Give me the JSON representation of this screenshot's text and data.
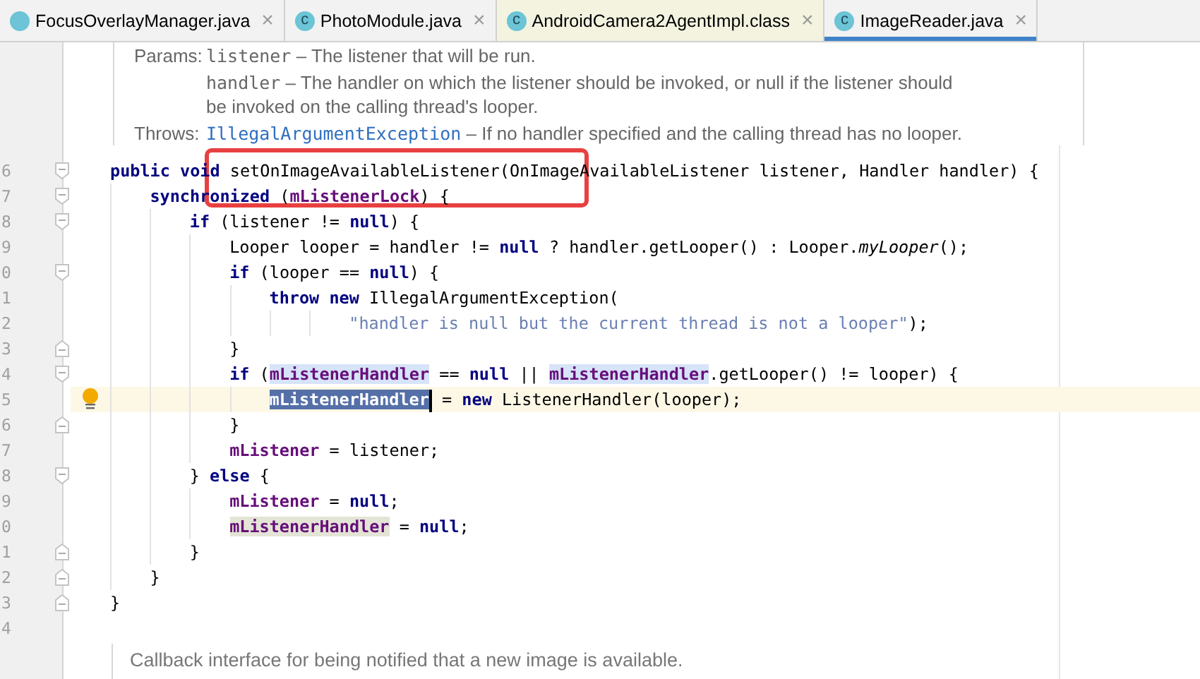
{
  "tabs": [
    {
      "label": "FocusOverlayManager.java",
      "kind": "java",
      "selected": false,
      "close": "×"
    },
    {
      "label": "PhotoModule.java",
      "kind": "java",
      "selected": false,
      "close": "×",
      "badge": "c"
    },
    {
      "label": "AndroidCamera2AgentImpl.class",
      "kind": "class",
      "selected": false,
      "close": "×",
      "badge": "c"
    },
    {
      "label": "ImageReader.java",
      "kind": "java",
      "selected": true,
      "close": "×",
      "badge": "c"
    }
  ],
  "doc_top": {
    "params_label": "Params:",
    "params": [
      {
        "name": "listener",
        "text": "– The listener that will be run."
      },
      {
        "name": "handler",
        "text": "– The handler on which the listener should be invoked, or null if the listener should be invoked on the calling thread's looper."
      }
    ],
    "throws_label": "Throws:",
    "throws": {
      "name": "IllegalArgumentException",
      "text": "– If no handler specified and the calling thread has no looper."
    }
  },
  "code_lines": [
    {
      "number": "6",
      "kind": "statement",
      "fold_start": true,
      "fold_end": false,
      "current": false,
      "bulb": false,
      "tokens": [
        {
          "kind": "keyword",
          "text": "public void"
        },
        {
          "kind": "plain",
          "text": " setOnImageAvailableListener(OnImageAvailableListener listener, Handler handler) {"
        }
      ],
      "children": [
        {
          "number": "7",
          "kind": "statement",
          "fold_start": true,
          "fold_end": false,
          "current": false,
          "bulb": false,
          "tokens": [
            {
              "kind": "keyword",
              "text": "synchronized"
            },
            {
              "kind": "plain",
              "text": " ("
            },
            {
              "kind": "field",
              "text": "mListenerLock"
            },
            {
              "kind": "plain",
              "text": ") {"
            }
          ],
          "children": [
            {
              "number": "8",
              "kind": "statement",
              "fold_start": true,
              "fold_end": false,
              "current": false,
              "bulb": false,
              "tokens": [
                {
                  "kind": "keyword",
                  "text": "if"
                },
                {
                  "kind": "plain",
                  "text": " (listener != "
                },
                {
                  "kind": "keyword",
                  "text": "null"
                },
                {
                  "kind": "plain",
                  "text": ") {"
                }
              ],
              "children": [
                {
                  "number": "9",
                  "kind": "statement",
                  "fold_start": false,
                  "fold_end": false,
                  "current": false,
                  "bulb": false,
                  "tokens": [
                    {
                      "kind": "plain",
                      "text": "Looper looper = handler != "
                    },
                    {
                      "kind": "keyword",
                      "text": "null"
                    },
                    {
                      "kind": "plain",
                      "text": " ? handler.getLooper() : Looper."
                    },
                    {
                      "kind": "static",
                      "text": "myLooper"
                    },
                    {
                      "kind": "plain",
                      "text": "();"
                    }
                  ]
                },
                {
                  "number": "0",
                  "kind": "statement",
                  "fold_start": true,
                  "fold_end": false,
                  "current": false,
                  "bulb": false,
                  "tokens": [
                    {
                      "kind": "keyword",
                      "text": "if"
                    },
                    {
                      "kind": "plain",
                      "text": " (looper == "
                    },
                    {
                      "kind": "keyword",
                      "text": "null"
                    },
                    {
                      "kind": "plain",
                      "text": ") {"
                    }
                  ],
                  "children": [
                    {
                      "number": "1",
                      "kind": "statement",
                      "fold_start": false,
                      "fold_end": false,
                      "current": false,
                      "bulb": false,
                      "tokens": [
                        {
                          "kind": "keyword",
                          "text": "throw new"
                        },
                        {
                          "kind": "plain",
                          "text": " IllegalArgumentException("
                        }
                      ],
                      "children": [
                        {
                          "number": "2",
                          "kind": "continuation",
                          "fold_start": false,
                          "fold_end": false,
                          "current": false,
                          "bulb": false,
                          "tokens": [
                            {
                              "kind": "string",
                              "text": "\"handler is null but the current thread is not a looper\""
                            },
                            {
                              "kind": "plain",
                              "text": ");"
                            }
                          ]
                        }
                      ]
                    }
                  ]
                },
                {
                  "number": "3",
                  "kind": "statement",
                  "fold_start": false,
                  "fold_end": true,
                  "current": false,
                  "bulb": false,
                  "tokens": [
                    {
                      "kind": "plain",
                      "text": "}"
                    }
                  ]
                },
                {
                  "number": "4",
                  "kind": "statement",
                  "fold_start": true,
                  "fold_end": false,
                  "current": false,
                  "bulb": false,
                  "tokens": [
                    {
                      "kind": "keyword",
                      "text": "if"
                    },
                    {
                      "kind": "plain",
                      "text": " ("
                    },
                    {
                      "kind": "field-usage",
                      "text": "mListenerHandler"
                    },
                    {
                      "kind": "plain",
                      "text": " == "
                    },
                    {
                      "kind": "keyword",
                      "text": "null"
                    },
                    {
                      "kind": "plain",
                      "text": " || "
                    },
                    {
                      "kind": "field-usage",
                      "text": "mListenerHandler"
                    },
                    {
                      "kind": "plain",
                      "text": ".getLooper() != looper) {"
                    }
                  ],
                  "children": [
                    {
                      "number": "5",
                      "kind": "statement",
                      "fold_start": false,
                      "fold_end": false,
                      "current": true,
                      "bulb": true,
                      "tokens": [
                        {
                          "kind": "field-selected",
                          "text": "mListenerHandler",
                          "caret": true
                        },
                        {
                          "kind": "plain",
                          "text": " = "
                        },
                        {
                          "kind": "keyword",
                          "text": "new"
                        },
                        {
                          "kind": "plain",
                          "text": " ListenerHandler(looper);"
                        }
                      ]
                    }
                  ]
                },
                {
                  "number": "6",
                  "kind": "statement",
                  "fold_start": false,
                  "fold_end": true,
                  "current": false,
                  "bulb": false,
                  "tokens": [
                    {
                      "kind": "plain",
                      "text": "}"
                    }
                  ]
                },
                {
                  "number": "7",
                  "kind": "statement",
                  "fold_start": false,
                  "fold_end": false,
                  "current": false,
                  "bulb": false,
                  "tokens": [
                    {
                      "kind": "field",
                      "text": "mListener"
                    },
                    {
                      "kind": "plain",
                      "text": " = listener;"
                    }
                  ]
                }
              ]
            },
            {
              "number": "8",
              "kind": "statement",
              "fold_start": true,
              "fold_end": false,
              "current": false,
              "bulb": false,
              "tokens": [
                {
                  "kind": "plain",
                  "text": "} "
                },
                {
                  "kind": "keyword",
                  "text": "else"
                },
                {
                  "kind": "plain",
                  "text": " {"
                }
              ],
              "children": [
                {
                  "number": "9",
                  "kind": "statement",
                  "fold_start": false,
                  "fold_end": false,
                  "current": false,
                  "bulb": false,
                  "tokens": [
                    {
                      "kind": "field",
                      "text": "mListener"
                    },
                    {
                      "kind": "plain",
                      "text": " = "
                    },
                    {
                      "kind": "keyword",
                      "text": "null"
                    },
                    {
                      "kind": "plain",
                      "text": ";"
                    }
                  ]
                },
                {
                  "number": "0",
                  "kind": "statement",
                  "fold_start": false,
                  "fold_end": false,
                  "current": false,
                  "bulb": false,
                  "tokens": [
                    {
                      "kind": "field-write",
                      "text": "mListenerHandler"
                    },
                    {
                      "kind": "plain",
                      "text": " = "
                    },
                    {
                      "kind": "keyword",
                      "text": "null"
                    },
                    {
                      "kind": "plain",
                      "text": ";"
                    }
                  ]
                }
              ]
            },
            {
              "number": "1",
              "kind": "statement",
              "fold_start": false,
              "fold_end": true,
              "current": false,
              "bulb": false,
              "tokens": [
                {
                  "kind": "plain",
                  "text": "}"
                }
              ]
            }
          ]
        },
        {
          "number": "2",
          "kind": "statement",
          "fold_start": false,
          "fold_end": true,
          "current": false,
          "bulb": false,
          "tokens": [
            {
              "kind": "plain",
              "text": "}"
            }
          ]
        }
      ]
    },
    {
      "number": "3",
      "kind": "statement",
      "fold_start": false,
      "fold_end": true,
      "current": false,
      "bulb": false,
      "tokens": [
        {
          "kind": "plain",
          "text": "}"
        }
      ]
    },
    {
      "number": "4",
      "fold_start": false,
      "fold_end": false,
      "current": false,
      "bulb": false
    }
  ],
  "doc_bottom": {
    "text": "Callback interface for being notified that a new image is available."
  }
}
